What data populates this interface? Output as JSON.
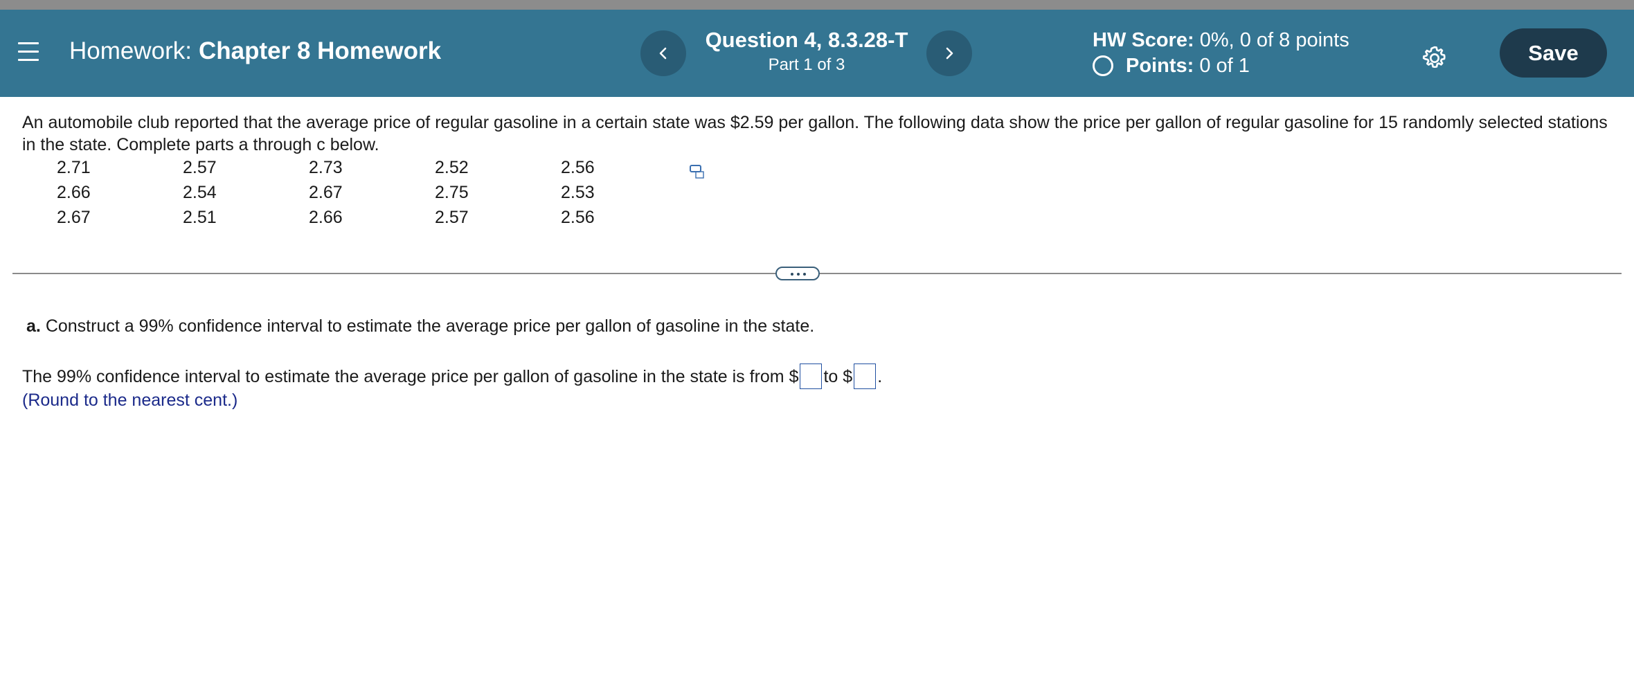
{
  "header": {
    "homework_prefix": "Homework:",
    "homework_name": "Chapter 8 Homework",
    "question_title": "Question 4, 8.3.28-T",
    "question_part": "Part 1 of 3",
    "hw_score_label": "HW Score:",
    "hw_score_value": "0%, 0 of 8 points",
    "points_label": "Points:",
    "points_value": "0 of 1",
    "save_label": "Save",
    "icons": [
      "menu-icon",
      "chevron-left-icon",
      "chevron-right-icon",
      "status-circle-icon",
      "gear-icon"
    ]
  },
  "problem": {
    "text": "An automobile club reported that the average price of regular gasoline in a certain state was $2.59 per gallon. The following data show the price per gallon of regular gasoline for 15 randomly selected stations in the state. Complete parts a through c below.",
    "data": [
      [
        "2.71",
        "2.57",
        "2.73",
        "2.52",
        "2.56"
      ],
      [
        "2.66",
        "2.54",
        "2.67",
        "2.75",
        "2.53"
      ],
      [
        "2.67",
        "2.51",
        "2.66",
        "2.57",
        "2.56"
      ]
    ]
  },
  "part_a": {
    "label": "a.",
    "question": "Construct a 99% confidence interval to estimate the average price per gallon of gasoline in the state.",
    "answer_prefix": "The 99% confidence interval to estimate the average price per gallon of gasoline in the state is from $",
    "answer_mid": "to $",
    "answer_suffix": ".",
    "lower_value": "",
    "upper_value": "",
    "note": "(Round to the nearest cent.)"
  },
  "colors": {
    "header_bg": "#347592",
    "nav_button": "#295c75",
    "save_button": "#1e3a4c",
    "note_text": "#1b2a8a",
    "answer_box_border": "#1f4fa0"
  }
}
